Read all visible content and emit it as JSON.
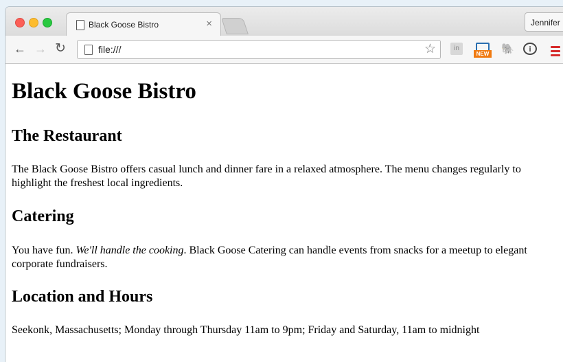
{
  "browser": {
    "tab_title": "Black Goose Bistro",
    "tab_close": "×",
    "profile_name": "Jennifer",
    "url": "file:///",
    "icons": {
      "back": "back-arrow-icon",
      "forward": "forward-arrow-icon",
      "reload": "reload-icon",
      "bookmark": "star-icon",
      "extension_in": "in",
      "extension_new_badge": "NEW",
      "menu": "hamburger-menu-icon"
    }
  },
  "page": {
    "heading": "Black Goose Bistro",
    "sections": [
      {
        "title": "The Restaurant",
        "body": "The Black Goose Bistro offers casual lunch and dinner fare in a relaxed atmosphere. The menu changes regularly to highlight the freshest local ingredients."
      },
      {
        "title": "Catering",
        "body_before": "You have fun. ",
        "body_emphasis": "We'll handle the cooking",
        "body_after": ". Black Goose Catering can handle events from snacks for a meetup to elegant corporate fundraisers."
      },
      {
        "title": "Location and Hours",
        "body": "Seekonk, Massachusetts; Monday through Thursday 11am to 9pm; Friday and Saturday, 11am to midnight"
      }
    ]
  }
}
